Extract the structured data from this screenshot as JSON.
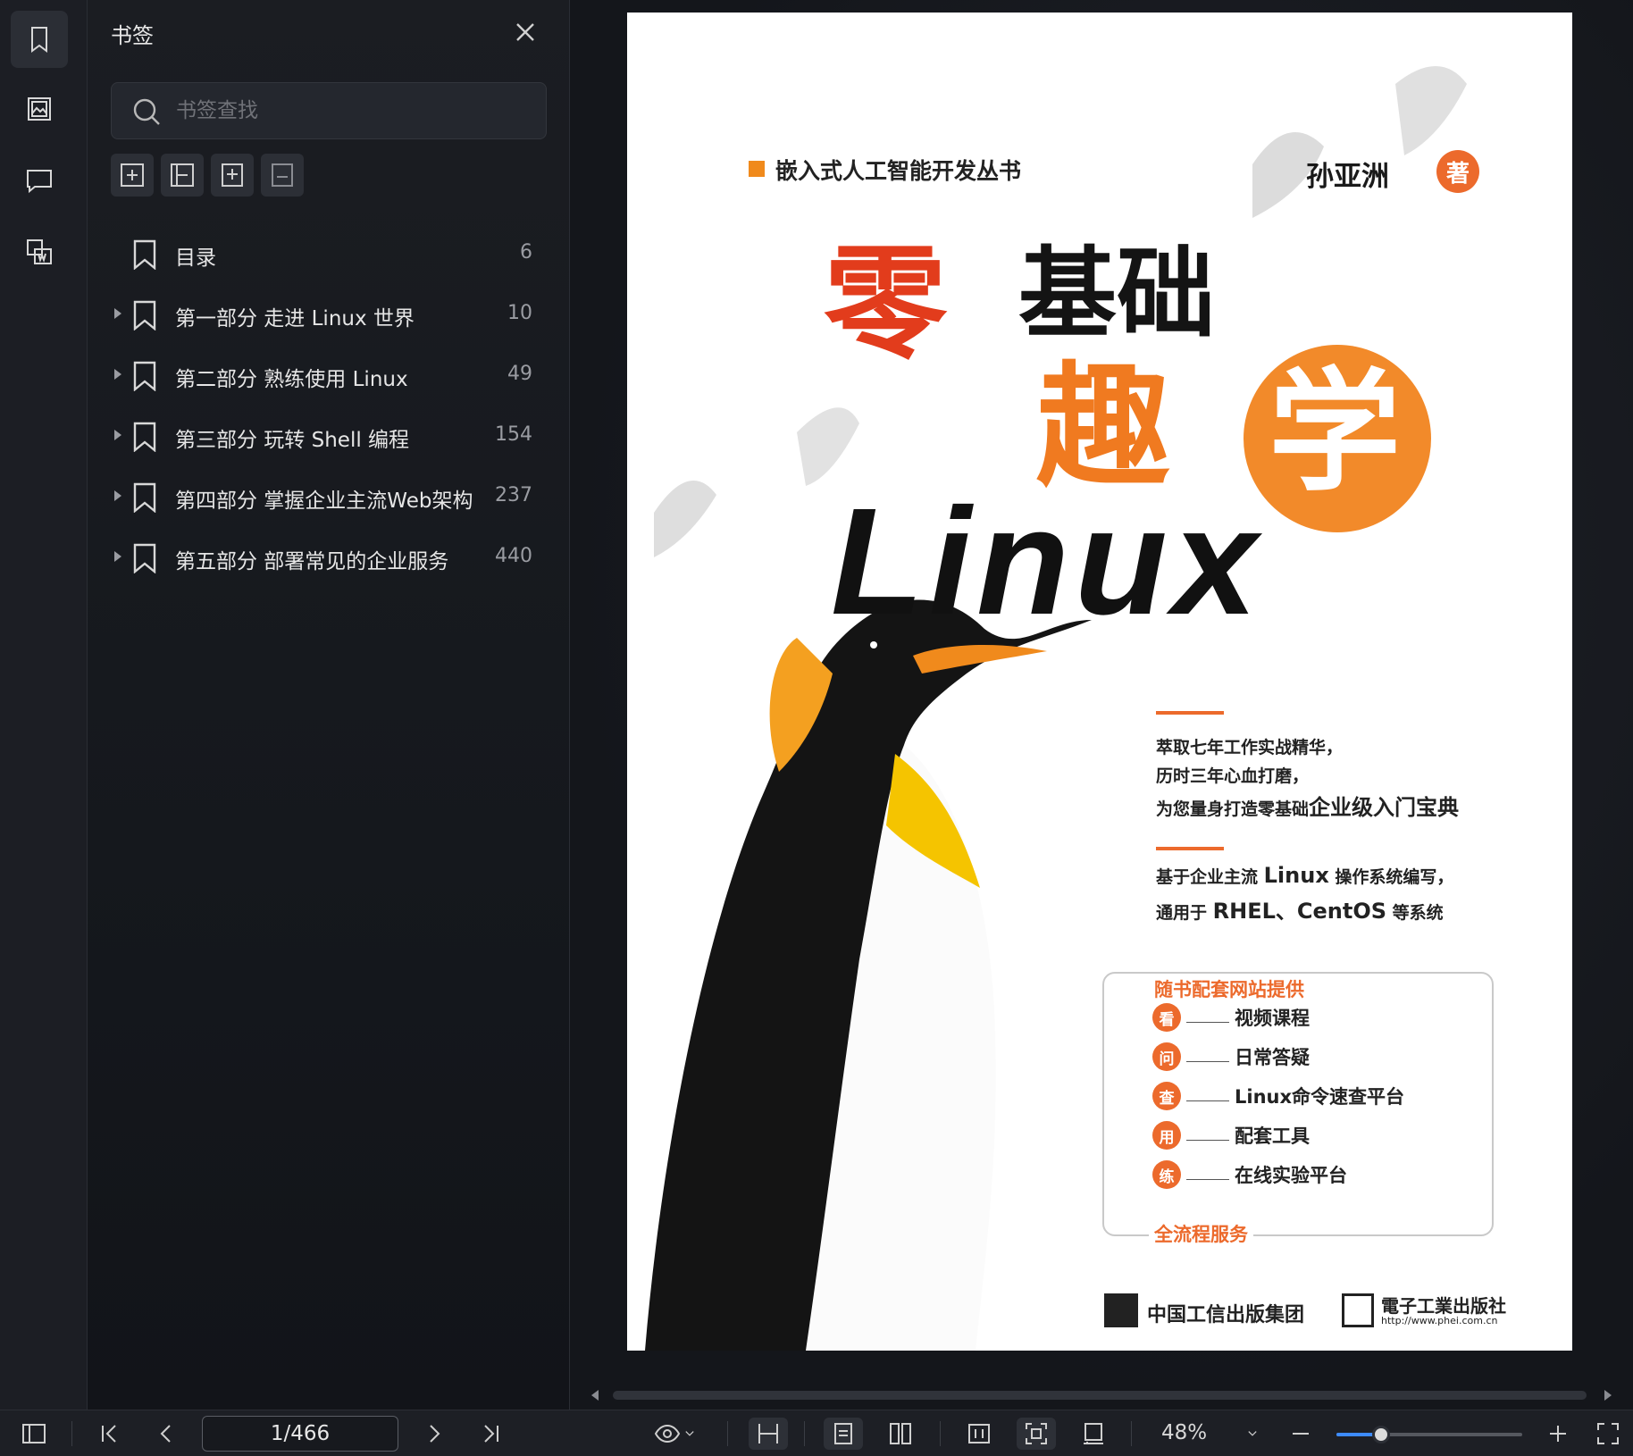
{
  "colors": {
    "accent_blue": "#3d8bff",
    "cover_orange": "#ec6a2c",
    "cover_red": "#e23c1c",
    "panel_bg": "#1b1d22"
  },
  "rail": {
    "items": [
      {
        "icon": "bookmark-icon",
        "active": true
      },
      {
        "icon": "image-icon",
        "active": false
      },
      {
        "icon": "comment-icon",
        "active": false
      },
      {
        "icon": "convert-word-icon",
        "active": false
      }
    ]
  },
  "bookmark_panel": {
    "title": "书签",
    "search_placeholder": "书签查找",
    "tools": [
      "add-bookmark-icon",
      "collapse-bookmark-icon",
      "add-child-bookmark-icon",
      "remove-bookmark-icon"
    ],
    "items": [
      {
        "label": "目录",
        "page": "6",
        "expandable": false
      },
      {
        "label": "第一部分 走进 Linux 世界",
        "page": "10",
        "expandable": true
      },
      {
        "label": "第二部分 熟练使用 Linux",
        "page": "49",
        "expandable": true
      },
      {
        "label": "第三部分 玩转 Shell 编程",
        "page": "154",
        "expandable": true
      },
      {
        "label": "第四部分 掌握企业主流Web架构",
        "page": "237",
        "expandable": true
      },
      {
        "label": "第五部分 部署常见的企业服务",
        "page": "440",
        "expandable": true
      }
    ]
  },
  "cover": {
    "series": "嵌入式人工智能开发丛书",
    "author": "孙亚洲",
    "author_badge": "著",
    "title_1": "零",
    "title_2": "基础",
    "title_3": "趣",
    "title_4": "学",
    "title_linux": "Linux",
    "blurb_1": "萃取七年工作实战精华，",
    "blurb_2": "历时三年心血打磨，",
    "blurb_3a": "为您量身打造零基础",
    "blurb_3b": "企业级入门宝典",
    "blurb_4a": "基于企业主流 ",
    "blurb_4b": "Linux",
    "blurb_4c": " 操作系统编写，",
    "blurb_5a": "通用于 ",
    "blurb_5b": "RHEL、CentOS",
    "blurb_5c": " 等系统",
    "box_title": "随书配套网站提供",
    "box_items": [
      {
        "badge": "看",
        "text": "视频课程"
      },
      {
        "badge": "问",
        "text": "日常答疑"
      },
      {
        "badge": "查",
        "text": "Linux命令速查平台"
      },
      {
        "badge": "用",
        "text": "配套工具"
      },
      {
        "badge": "练",
        "text": "在线实验平台"
      }
    ],
    "box_footer": "全流程服务",
    "publisher_1": "中国工信出版集团",
    "publisher_2": "電子工業出版社",
    "publisher_2_url": "http://www.phei.com.cn"
  },
  "toolbar": {
    "page_value": "1/466",
    "zoom": "48%",
    "zoom_level": 0.24
  }
}
